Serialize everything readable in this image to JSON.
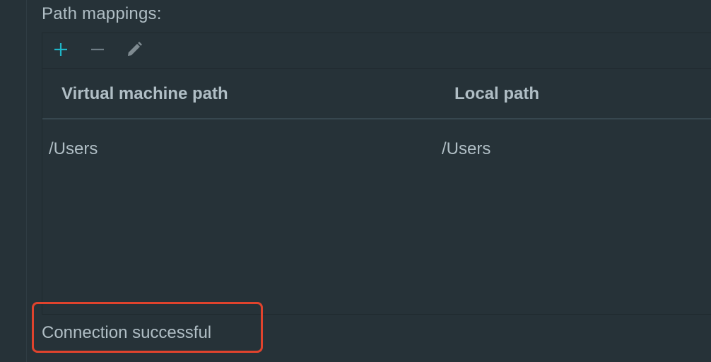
{
  "path_mappings": {
    "label": "Path mappings:",
    "toolbar": {
      "add_icon": "plus-icon",
      "remove_icon": "minus-icon",
      "edit_icon": "pencil-icon"
    },
    "columns": [
      "Virtual machine path",
      "Local path"
    ],
    "rows": [
      {
        "vm_path": "/Users",
        "local_path": "/Users"
      }
    ]
  },
  "status": {
    "text": "Connection successful"
  },
  "colors": {
    "background": "#263238",
    "text": "#b0bec5",
    "add_accent": "#1fb6c8",
    "highlight_border": "#e0432d"
  }
}
